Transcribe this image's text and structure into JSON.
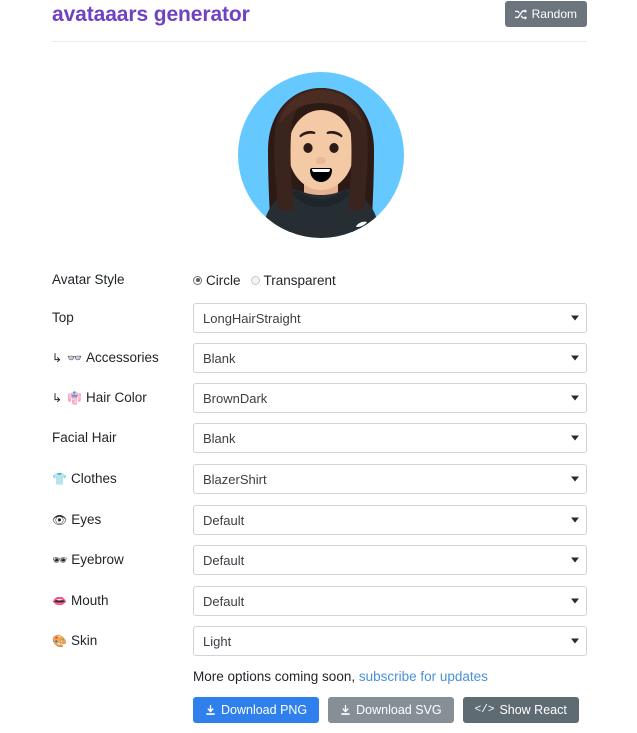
{
  "header": {
    "title": "avataaars generator",
    "random_button": {
      "label": "Random",
      "icon": "shuffle-icon"
    }
  },
  "avatar": {
    "style": "Circle",
    "background_color": "#65C9FF",
    "skin_color": "#F3C9A6",
    "hair_color": "#3A241D",
    "hair_highlight": "#4A2C23",
    "clothes_color": "#262E33",
    "clothes_accent": "#FFFFFF",
    "eye_color": "#2C1B18",
    "mouth_color": "#000000",
    "teeth_color": "#FFFFFF"
  },
  "form": {
    "avatar_style": {
      "label": "Avatar Style",
      "options": [
        {
          "label": "Circle",
          "selected": true
        },
        {
          "label": "Transparent",
          "selected": false
        }
      ]
    },
    "fields": [
      {
        "label": "Top",
        "icon": null,
        "sub": false,
        "value": "LongHairStraight"
      },
      {
        "label": "Accessories",
        "icon": "glasses-icon",
        "sub": true,
        "value": "Blank"
      },
      {
        "label": "Hair Color",
        "icon": "hair-color-icon",
        "sub": true,
        "value": "BrownDark"
      },
      {
        "label": "Facial Hair",
        "icon": null,
        "sub": false,
        "value": "Blank"
      },
      {
        "label": "Clothes",
        "icon": "tshirt-icon",
        "sub": false,
        "value": "BlazerShirt"
      },
      {
        "label": "Eyes",
        "icon": "eye-icon",
        "sub": false,
        "value": "Default"
      },
      {
        "label": "Eyebrow",
        "icon": "eyebrow-icon",
        "sub": false,
        "value": "Default"
      },
      {
        "label": "Mouth",
        "icon": "mouth-icon",
        "sub": false,
        "value": "Default"
      },
      {
        "label": "Skin",
        "icon": "palette-icon",
        "sub": false,
        "value": "Light"
      }
    ]
  },
  "footer": {
    "more_options_text": "More options coming soon,",
    "subscribe_link": "subscribe for updates",
    "buttons": [
      {
        "label": "Download PNG",
        "icon": "download-icon",
        "style": "primary"
      },
      {
        "label": "Download SVG",
        "icon": "download-icon",
        "style": "secondary"
      },
      {
        "label": "Show React",
        "icon": "code-icon",
        "style": "dark"
      }
    ]
  },
  "colors": {
    "title_purple": "#6f42c1",
    "primary_blue": "#2f80ed",
    "link_blue": "#4a90d9",
    "gray": "#6c757d",
    "border": "#ced4da"
  }
}
